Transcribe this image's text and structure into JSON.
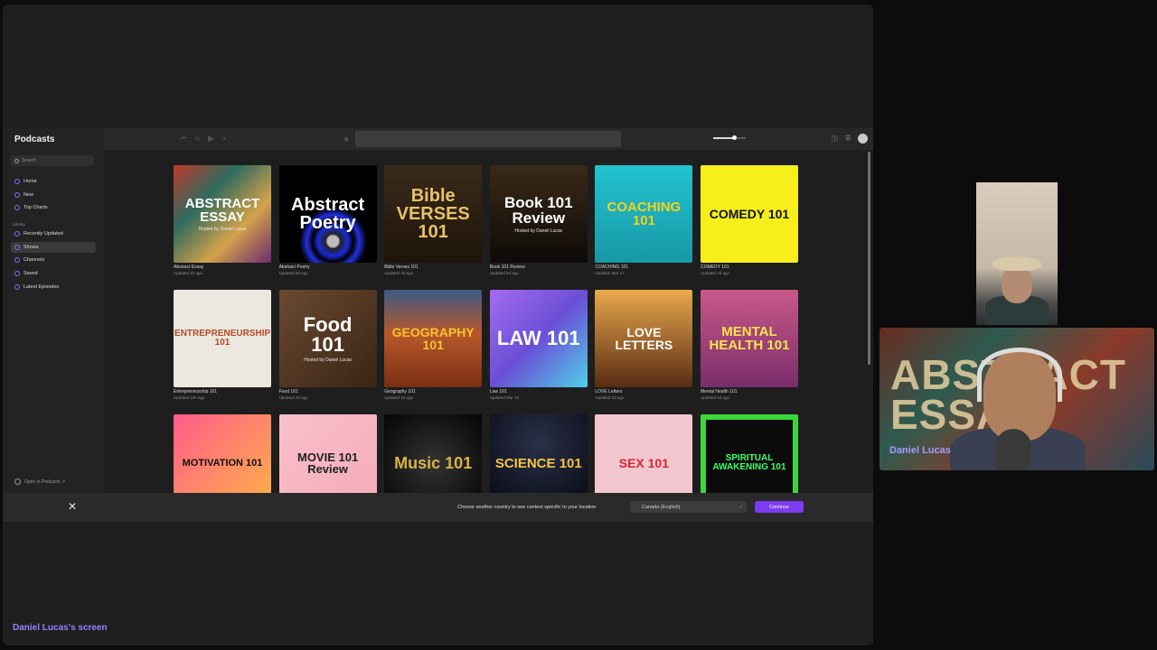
{
  "app": {
    "name": "Podcasts",
    "search_placeholder": "Search",
    "nav": [
      {
        "label": "Home"
      },
      {
        "label": "New"
      },
      {
        "label": "Top Charts"
      }
    ],
    "library_heading": "Library",
    "library": [
      {
        "label": "Recently Updated"
      },
      {
        "label": "Shows",
        "active": true
      },
      {
        "label": "Channels"
      },
      {
        "label": "Saved"
      },
      {
        "label": "Latest Episodes"
      }
    ],
    "open_in_podcasts": "Open in Podcasts ↗",
    "volume_level": 0.65
  },
  "shows": [
    {
      "title": "Abstract Essay",
      "updated": "Updated 1h ago",
      "art": "ABSTRACT ESSAY",
      "art_sub": "Hosted by Daniel Lucas",
      "bg": "#8b3a2f"
    },
    {
      "title": "Abstract Poetry",
      "updated": "Updated 6d ago",
      "art": "Abstract Poetry",
      "art_sub": "",
      "bg": "#000000"
    },
    {
      "title": "Bible Verses 101",
      "updated": "Updated 4d ago",
      "art": "Bible VERSES 101",
      "art_sub": "",
      "bg": "#2a2015"
    },
    {
      "title": "Book 101 Review",
      "updated": "Updated 5d ago",
      "art": "Book 101 Review",
      "art_sub": "Hosted by Daniel Lucas",
      "bg": "#1a1410"
    },
    {
      "title": "COACHING 101",
      "updated": "Updated Mar 17",
      "art": "COACHING 101",
      "art_sub": "",
      "bg": "#1fb3c1"
    },
    {
      "title": "COMEDY 101",
      "updated": "Updated 2d ago",
      "art": "COMEDY 101",
      "art_sub": "",
      "bg": "#f7ef1c"
    },
    {
      "title": "Entrepreneurship 101",
      "updated": "Updated 19h ago",
      "art": "ENTREPRENEURSHIP 101",
      "art_sub": "",
      "bg": "#ece7df"
    },
    {
      "title": "Food 101",
      "updated": "Updated 4d ago",
      "art": "Food 101",
      "art_sub": "Hosted by Daniel Lucas",
      "bg": "#5a3a25"
    },
    {
      "title": "Geography 101",
      "updated": "Updated 2d ago",
      "art": "GEOGRAPHY 101",
      "art_sub": "",
      "bg": "#b5552a"
    },
    {
      "title": "Law 101",
      "updated": "Updated Mar 15",
      "art": "LAW 101",
      "art_sub": "",
      "bg": "#8f5ad6"
    },
    {
      "title": "LOVE Letters",
      "updated": "Updated 2d ago",
      "art": "LOVE LETTERS",
      "art_sub": "",
      "bg": "#d8872e"
    },
    {
      "title": "Mental Health 101",
      "updated": "Updated 5d ago",
      "art": "MENTAL HEALTH 101",
      "art_sub": "",
      "bg": "#c25d87"
    },
    {
      "title": "Motivation 101",
      "updated": "",
      "art": "MOTIVATION 101",
      "art_sub": "",
      "bg": "#f0457a"
    },
    {
      "title": "Movie 101 Review",
      "updated": "",
      "art": "MOVIE 101 Review",
      "art_sub": "",
      "bg": "#f5b9c4"
    },
    {
      "title": "Music 101",
      "updated": "",
      "art": "Music 101",
      "art_sub": "",
      "bg": "#111111"
    },
    {
      "title": "Science 101",
      "updated": "",
      "art": "SCIENCE 101",
      "art_sub": "",
      "bg": "#101624"
    },
    {
      "title": "Sex 101",
      "updated": "",
      "art": "SEX 101",
      "art_sub": "",
      "bg": "#f3c7cf"
    },
    {
      "title": "Spiritual Awakening 101",
      "updated": "",
      "art": "SPIRITUAL AWAKENING 101",
      "art_sub": "",
      "bg": "#0b0b0b"
    }
  ],
  "banner": {
    "text": "Choose another country to see content specific to your location",
    "country": "Canada (English)",
    "continue_label": "Continue"
  },
  "presenter": {
    "name": "Daniel Lucas",
    "screen_label": "Daniel Lucas's screen",
    "background_text": "ABSTRACT ESSAY"
  }
}
